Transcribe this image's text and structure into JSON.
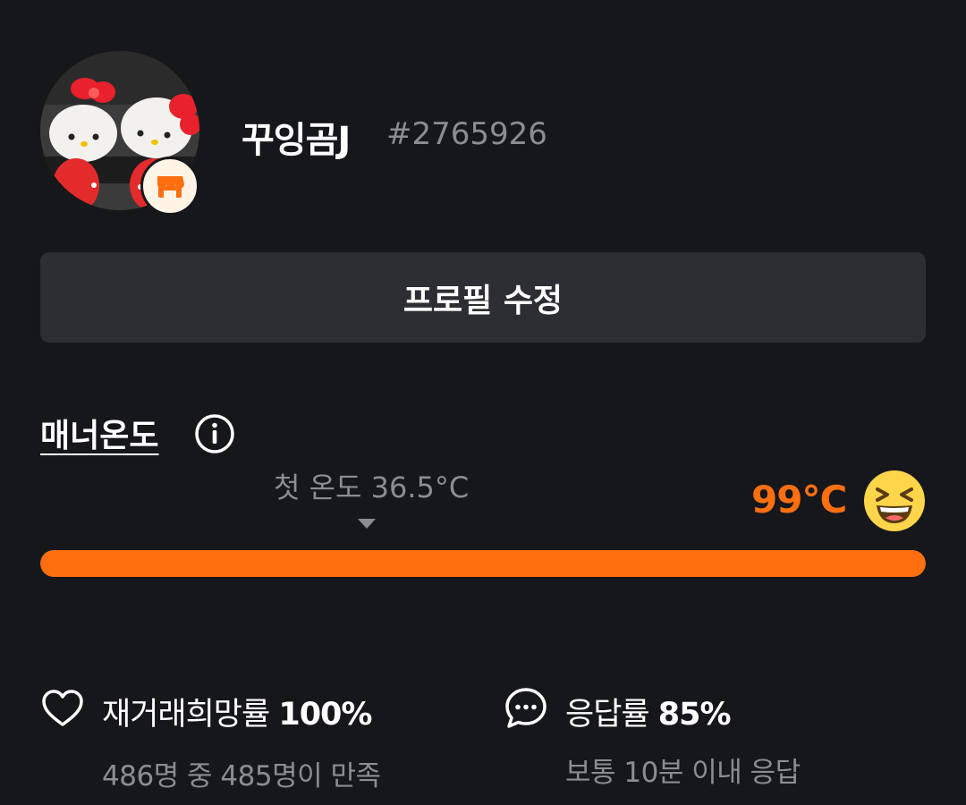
{
  "profile": {
    "nickname": "꾸잉곰J",
    "user_id": "#2765926",
    "avatar_icon": "hello-kitty-photo",
    "badge_icon": "store-icon"
  },
  "edit_profile": {
    "label": "프로필 수정"
  },
  "manner_temperature": {
    "title": "매너온도",
    "info_icon": "info-icon",
    "first_temp_label": "첫 온도 36.5°C",
    "current_value": "99°C",
    "current_temp_number": 99,
    "bar_fill_fraction": 1.0,
    "face_icon": "laughing-face-icon",
    "accent_color": "#ff6f0f"
  },
  "stats": {
    "rebuy": {
      "icon": "heart-icon",
      "label": "재거래희망률",
      "value": "100%",
      "sub": "486명 중 485명이 만족"
    },
    "response": {
      "icon": "chat-bubble-icon",
      "label": "응답률",
      "value": "85%",
      "sub": "보통 10분 이내 응답"
    }
  }
}
